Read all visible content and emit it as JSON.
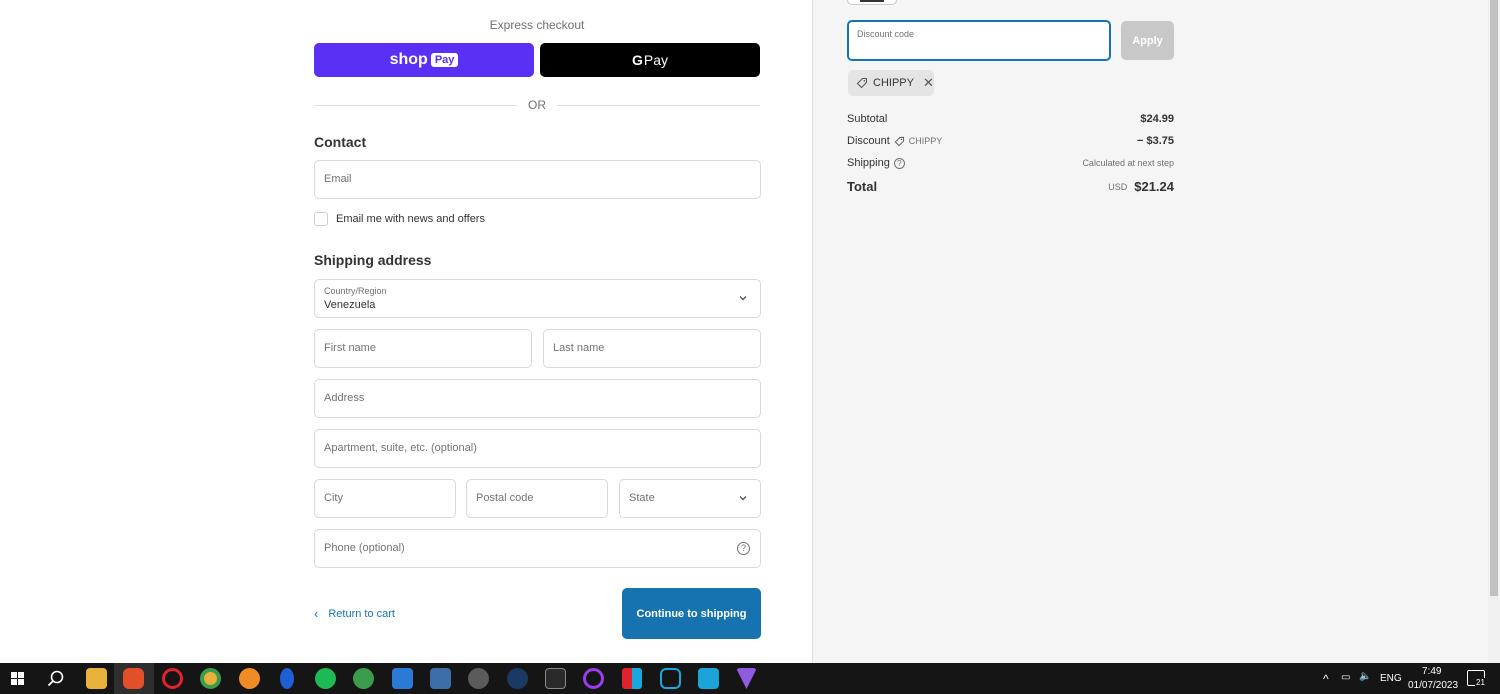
{
  "express": {
    "label": "Express checkout",
    "shop_pay": {
      "word": "shop",
      "pill": "Pay"
    },
    "g_pay": {
      "g": "G",
      "word": "Pay"
    },
    "or_text": "OR"
  },
  "contact": {
    "title": "Contact",
    "email_placeholder": "Email",
    "newsletter_label": "Email me with news and offers"
  },
  "shipping": {
    "title": "Shipping address",
    "country_label": "Country/Region",
    "country_value": "Venezuela",
    "first_name": "First name",
    "last_name": "Last name",
    "address": "Address",
    "apartment": "Apartment, suite, etc. (optional)",
    "city": "City",
    "postal": "Postal code",
    "state": "State",
    "phone": "Phone (optional)",
    "phone_help": "?"
  },
  "nav": {
    "return_label": "Return to cart",
    "continue_label": "Continue to shipping"
  },
  "summary": {
    "discount_placeholder": "Discount code",
    "apply_label": "Apply",
    "chip_code": "CHIPPY",
    "subtotal_label": "Subtotal",
    "subtotal_value": "$24.99",
    "discount_label": "Discount",
    "discount_code": "CHIPPY",
    "discount_value": "− $3.75",
    "shipping_label": "Shipping",
    "shipping_value": "Calculated at next step",
    "total_label": "Total",
    "currency": "USD",
    "total_value": "$21.24"
  },
  "taskbar": {
    "language": "ENG",
    "time": "7:49",
    "date": "01/07/2023",
    "notification_count": "21"
  },
  "colors": {
    "shop_pay": "#5a31f4",
    "accent": "#1773b0",
    "summary_bg": "#f5f5f5"
  }
}
